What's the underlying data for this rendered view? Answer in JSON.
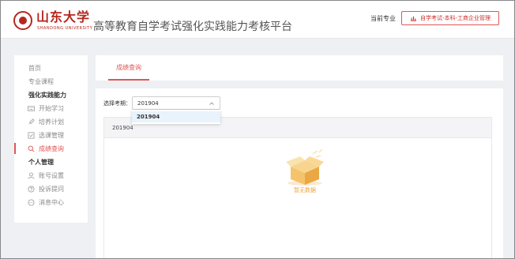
{
  "header": {
    "logo_cn": "山东大学",
    "logo_en": "SHANDONG UNIVERSITY",
    "title": "高等教育自学考试强化实践能力考核平台",
    "major_label": "当前专业",
    "major_value": "自学考试-本科-工商企业管理",
    "major_icon": "chart-icon"
  },
  "sidebar": {
    "items": [
      {
        "label": "首页",
        "type": "plain"
      },
      {
        "label": "专业课程",
        "type": "plain"
      },
      {
        "label": "强化实践能力",
        "type": "group"
      },
      {
        "label": "开始学习",
        "type": "sub",
        "icon": "keyboard-icon"
      },
      {
        "label": "培养计划",
        "type": "sub",
        "icon": "rocket-icon"
      },
      {
        "label": "选课管理",
        "type": "sub",
        "icon": "checkbox-icon"
      },
      {
        "label": "成绩查询",
        "type": "sub",
        "icon": "search-icon",
        "active": true
      },
      {
        "label": "个人管理",
        "type": "group"
      },
      {
        "label": "账号设置",
        "type": "sub",
        "icon": "user-icon"
      },
      {
        "label": "投诉提问",
        "type": "sub",
        "icon": "help-icon"
      },
      {
        "label": "消息中心",
        "type": "sub",
        "icon": "message-icon"
      }
    ]
  },
  "tabs": {
    "active": "成绩查询"
  },
  "filter": {
    "label": "选择考期：",
    "value": "201904",
    "options": [
      "201904"
    ]
  },
  "table": {
    "header": "201904",
    "empty_text": "暂无数据"
  },
  "colors": {
    "accent": "#e05656",
    "brand": "#b5271f",
    "empty": "#f0a23a"
  }
}
